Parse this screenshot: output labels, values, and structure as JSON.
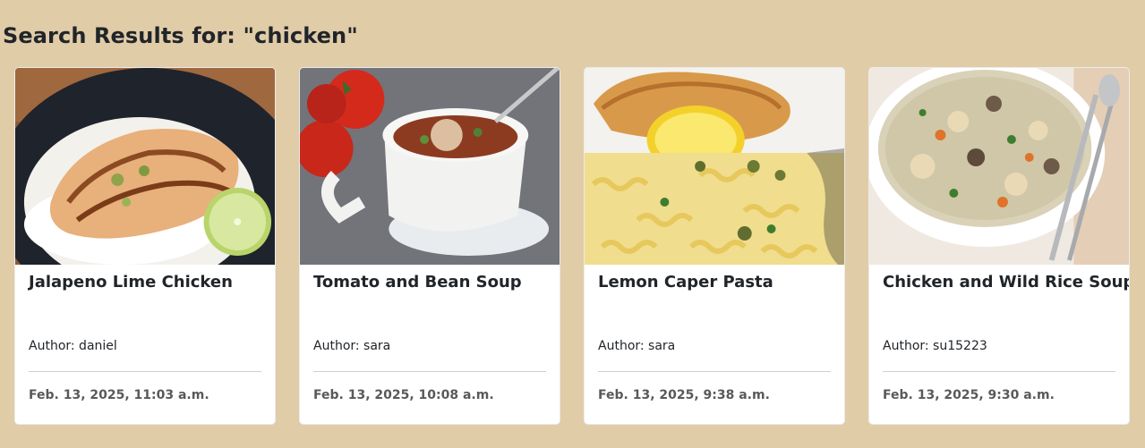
{
  "page": {
    "title": "Search Results for: \"chicken\""
  },
  "results": [
    {
      "title": "Jalapeno Lime Chicken",
      "author": "Author: daniel",
      "date": "Feb. 13, 2025, 11:03 a.m."
    },
    {
      "title": "Tomato and Bean Soup",
      "author": "Author: sara",
      "date": "Feb. 13, 2025, 10:08 a.m."
    },
    {
      "title": "Lemon Caper Pasta",
      "author": "Author: sara",
      "date": "Feb. 13, 2025, 9:38 a.m."
    },
    {
      "title": "Chicken and Wild Rice Soup",
      "author": "Author: su15223",
      "date": "Feb. 13, 2025, 9:30 a.m."
    }
  ],
  "colors": {
    "background": "#e1cca8",
    "card": "#ffffff",
    "text": "#212529",
    "muted": "#595959"
  }
}
